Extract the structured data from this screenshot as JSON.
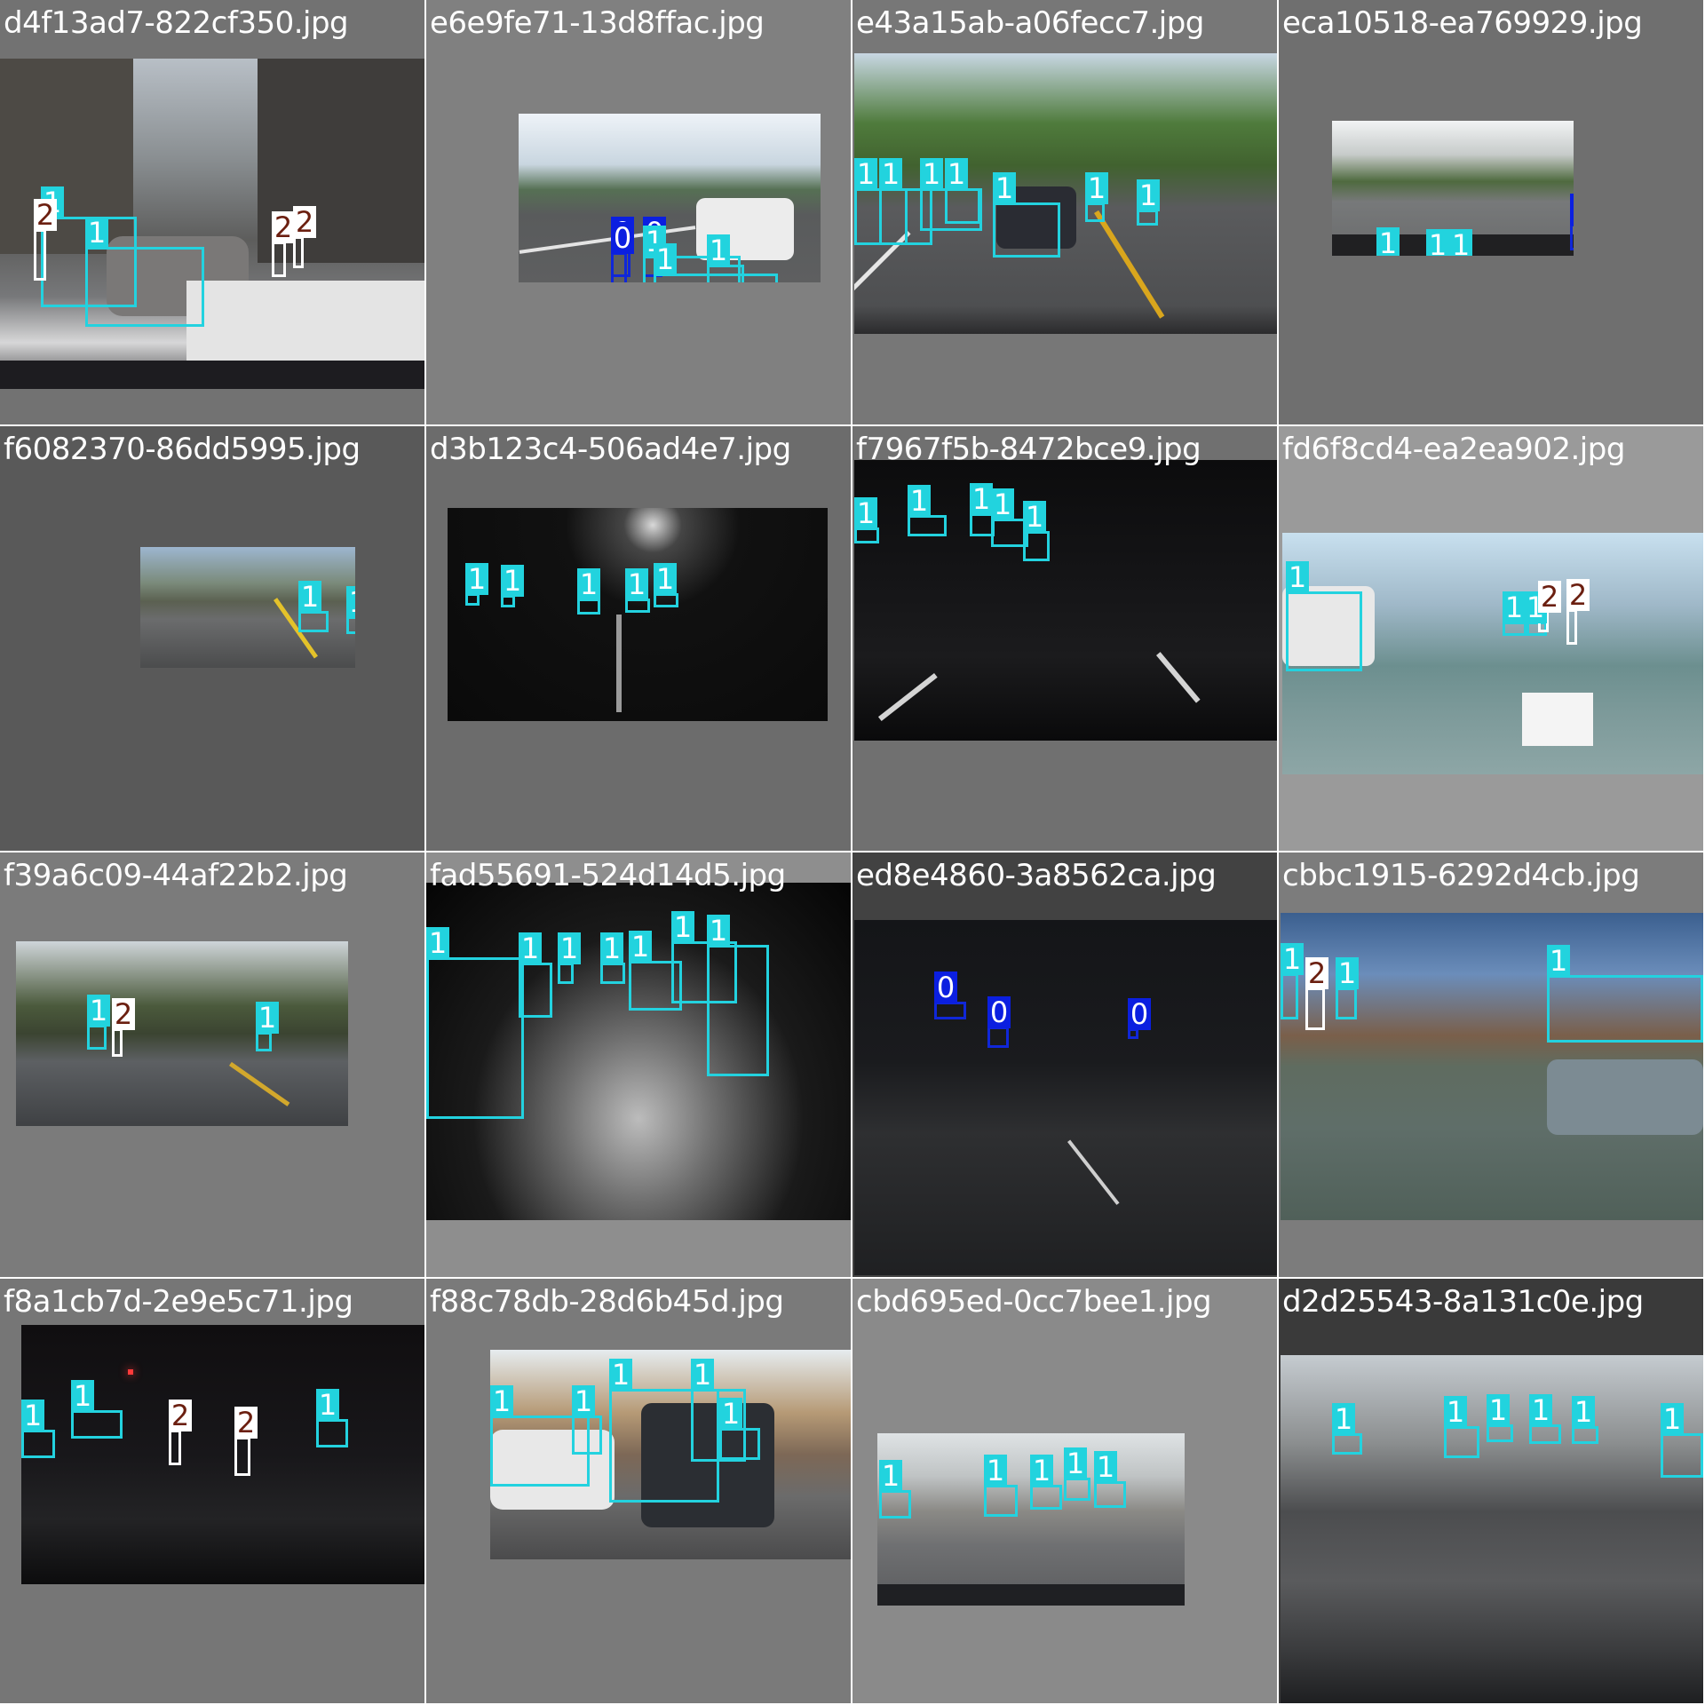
{
  "grid": {
    "tiles": [
      {
        "file": "d4f13ad7-822cf350.jpg",
        "bg": "#727272"
      },
      {
        "file": "e6e9fe71-13d8ffac.jpg",
        "bg": "#808080"
      },
      {
        "file": "e43a15ab-a06fecc7.jpg",
        "bg": "#777777"
      },
      {
        "file": "eca10518-ea769929.jpg",
        "bg": "#6f6f6f"
      },
      {
        "file": "f6082370-86dd5995.jpg",
        "bg": "#595959"
      },
      {
        "file": "d3b123c4-506ad4e7.jpg",
        "bg": "#6c6c6c"
      },
      {
        "file": "f7967f5b-8472bce9.jpg",
        "bg": "#707070"
      },
      {
        "file": "fd6f8cd4-ea2ea902.jpg",
        "bg": "#9a9a9a"
      },
      {
        "file": "f39a6c09-44af22b2.jpg",
        "bg": "#7b7b7b"
      },
      {
        "file": "fad55691-524d14d5.jpg",
        "bg": "#8e8e8e"
      },
      {
        "file": "ed8e4860-3a8562ca.jpg",
        "bg": "#424242"
      },
      {
        "file": "cbbc1915-6292d4cb.jpg",
        "bg": "#7c7c7c"
      },
      {
        "file": "f8a1cb7d-2e9e5c71.jpg",
        "bg": "#767676"
      },
      {
        "file": "f88c78db-28d6b45d.jpg",
        "bg": "#7a7a7a"
      },
      {
        "file": "cbd695ed-0cc7bee1.jpg",
        "bg": "#8a8a8a"
      },
      {
        "file": "d2d25543-8a131c0e.jpg",
        "bg": "#3a3a3a"
      }
    ],
    "class_labels": {
      "c0": "0",
      "c1": "1",
      "c2": "2"
    },
    "colors": {
      "class0": "#0b1fe0",
      "class1": "#22d3de",
      "class2_box": "#ffffff",
      "class2_text": "#6b1f10"
    }
  }
}
